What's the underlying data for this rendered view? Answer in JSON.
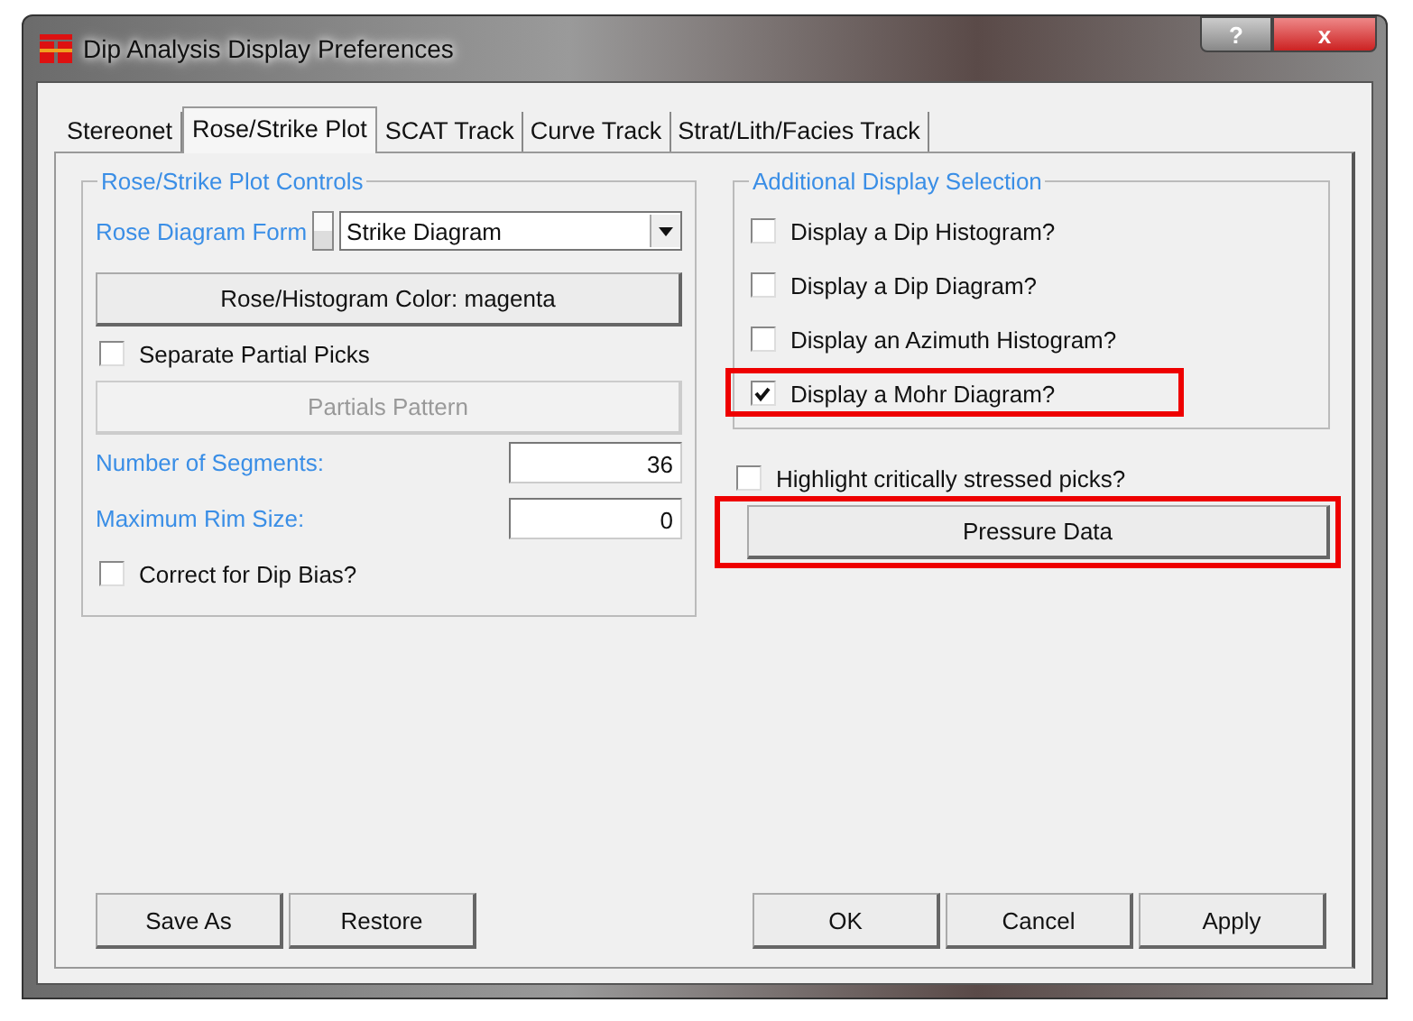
{
  "window": {
    "title": "Dip Analysis Display Preferences",
    "buttons": [
      {
        "kind": "help",
        "label": "?"
      },
      {
        "kind": "close",
        "label": "x"
      }
    ]
  },
  "tabs": [
    {
      "label": "Stereonet",
      "selected": false
    },
    {
      "label": "Rose/Strike Plot",
      "selected": true
    },
    {
      "label": "SCAT Track",
      "selected": false
    },
    {
      "label": "Curve Track",
      "selected": false
    },
    {
      "label": "Strat/Lith/Facies Track",
      "selected": false
    }
  ],
  "left_group": {
    "title": "Rose/Strike Plot Controls",
    "controls": [
      {
        "kind": "spin_dropdown",
        "label": "Rose Diagram Form",
        "value": "Strike Diagram",
        "disabled": false
      },
      {
        "kind": "button",
        "label": "Rose/Histogram Color:  magenta",
        "disabled": false
      },
      {
        "kind": "checkbox",
        "label": "Separate Partial Picks",
        "checked": false,
        "disabled": false
      },
      {
        "kind": "button",
        "label": "Partials Pattern",
        "disabled": true
      },
      {
        "kind": "field",
        "label": "Number of Segments:",
        "value": "36",
        "disabled": false
      },
      {
        "kind": "field",
        "label": "Maximum Rim Size:",
        "value": "0",
        "disabled": false
      },
      {
        "kind": "checkbox",
        "label": "Correct for Dip Bias?",
        "checked": false,
        "disabled": false
      }
    ]
  },
  "right_group": {
    "title": "Additional Display Selection",
    "checkboxes": [
      {
        "label": "Display a Dip Histogram?",
        "checked": false,
        "highlighted": false
      },
      {
        "label": "Display a Dip Diagram?",
        "checked": false,
        "highlighted": false
      },
      {
        "label": "Display an Azimuth Histogram?",
        "checked": false,
        "highlighted": false
      },
      {
        "label": "Display a Mohr Diagram?",
        "checked": true,
        "highlighted": true
      }
    ]
  },
  "right_extra": [
    {
      "kind": "checkbox",
      "label": "Highlight critically stressed picks?",
      "checked": false,
      "highlighted": false
    },
    {
      "kind": "button",
      "label": "Pressure Data",
      "highlighted": true
    }
  ],
  "footer_left": [
    "Save As",
    "Restore"
  ],
  "footer_right": [
    "OK",
    "Cancel",
    "Apply"
  ]
}
